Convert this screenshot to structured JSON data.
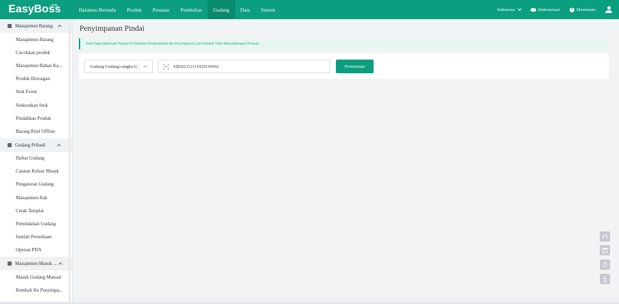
{
  "brand": {
    "name": "EasyBoss",
    "sup": ".com"
  },
  "nav": {
    "items": [
      "Halaman Beranda",
      "Produk",
      "Pesanan",
      "Pembelian",
      "Gudang",
      "Data",
      "Sistem"
    ],
    "active": "Gudang"
  },
  "topbar": {
    "language": "Indonesia",
    "sync": "Sinkronisasi",
    "help": "Membantu"
  },
  "sidebar": {
    "groups": [
      {
        "title": "Manajemen Barang",
        "items": [
          "Manajemen Barang",
          "Cocokkan produk",
          "Manajemen Bahan Ke...",
          "Produk Dorongan",
          "Stok Event",
          "Sinkronkan Stok",
          "Pindahkan Produk",
          "Barang Ritel Offline"
        ]
      },
      {
        "title": "Gudang Pribadi",
        "items": [
          "Daftar Gudang",
          "Catatan Keluar Masuk",
          "Pengaturan Gudang",
          "Manajemen Rak",
          "Cetak Templat",
          "Pemindahan Gudang",
          "Jumlah Persediaan",
          "Operasi PDA"
        ]
      },
      {
        "title": "Manajemen Masuk ...",
        "items": [
          "Masuk Gudang Manual",
          "Kembali Ke Penyimpa..."
        ]
      }
    ]
  },
  "main": {
    "title": "Penyimpanan Pindai",
    "alert": "Anda Dapat Memindai Pesanan Di Halaman [Pengembalian dan Penyimpanan], atau Pembeli Tidak Menandatangani Pesanan.",
    "warehouse_select": "Gudang Gudang:cangku1(",
    "scan_value": "EB20231211102911006​2",
    "button": "Permintaan"
  },
  "colors": {
    "primary": "#0b9e7f",
    "alert_bg": "#e8f6f1"
  },
  "float_buttons": [
    "headset-icon",
    "save-icon",
    "refresh-icon",
    "upload-icon"
  ]
}
